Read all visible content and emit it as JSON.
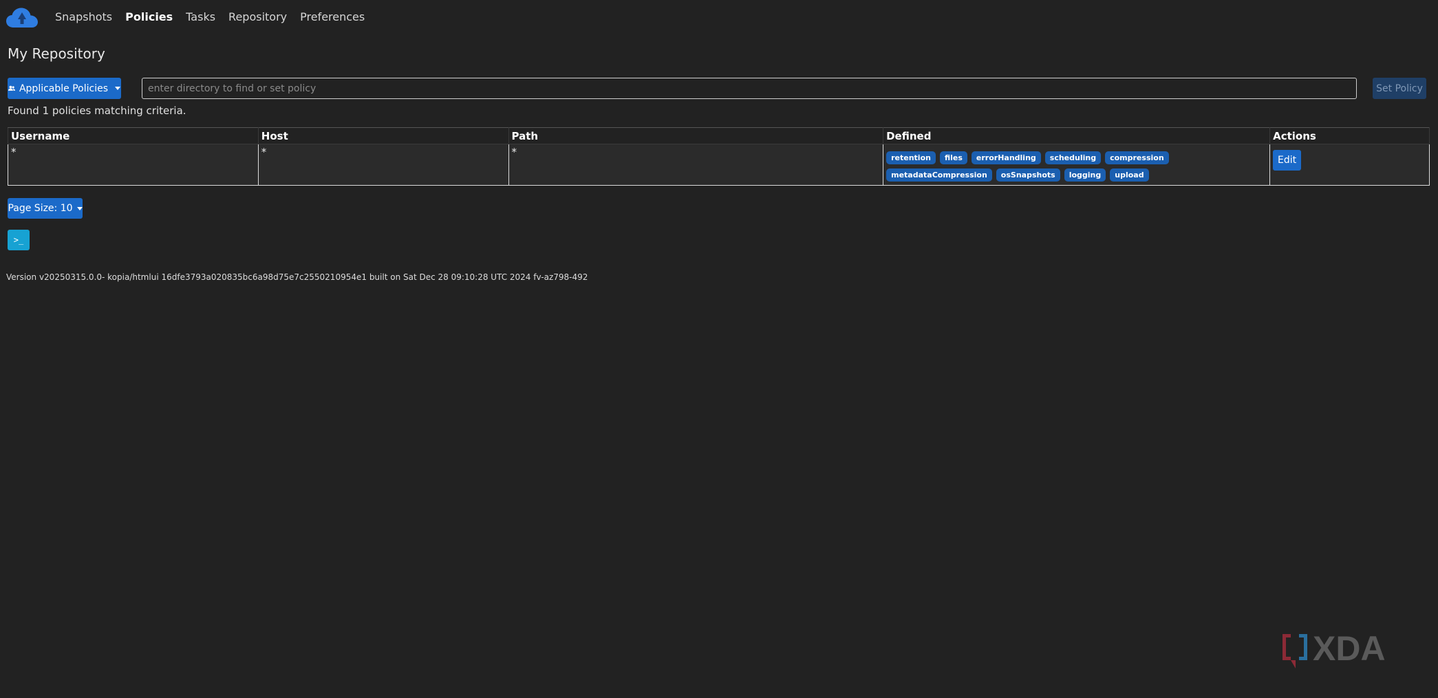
{
  "nav": {
    "logo_icon": "kopia-cloud-logo-icon",
    "items": [
      {
        "label": "Snapshots",
        "active": false
      },
      {
        "label": "Policies",
        "active": true
      },
      {
        "label": "Tasks",
        "active": false
      },
      {
        "label": "Repository",
        "active": false
      },
      {
        "label": "Preferences",
        "active": false
      }
    ]
  },
  "page": {
    "title": "My Repository"
  },
  "toolbar": {
    "applicable_policies_label": "Applicable Policies",
    "applicable_policies_icon": "users-icon",
    "search_placeholder": "enter directory to find or set policy",
    "search_value": "",
    "set_policy_label": "Set Policy"
  },
  "results": {
    "found_text": "Found 1 policies matching criteria."
  },
  "table": {
    "headers": [
      "Username",
      "Host",
      "Path",
      "Defined",
      "Actions"
    ],
    "rows": [
      {
        "username": "*",
        "host": "*",
        "path": "*",
        "defined": [
          "retention",
          "files",
          "errorHandling",
          "scheduling",
          "compression",
          "metadataCompression",
          "osSnapshots",
          "logging",
          "upload"
        ],
        "action_label": "Edit"
      }
    ]
  },
  "pagination": {
    "page_size_label": "Page Size: 10"
  },
  "terminal_button": {
    "label": ">_",
    "icon": "terminal-icon"
  },
  "footer": {
    "version": "Version v20250315.0.0- kopia/htmlui 16dfe3793a020835bc6a98d75e7c2550210954e1 built on Sat Dec 28 09:10:28 UTC 2024 fv-az798-492"
  },
  "watermark": {
    "text": "XDA"
  },
  "colors": {
    "background": "#222222",
    "primary": "#1b6ac9",
    "badge": "#1b5fb0",
    "terminal": "#17a2d3",
    "disabled_button": "#1f3f66"
  }
}
